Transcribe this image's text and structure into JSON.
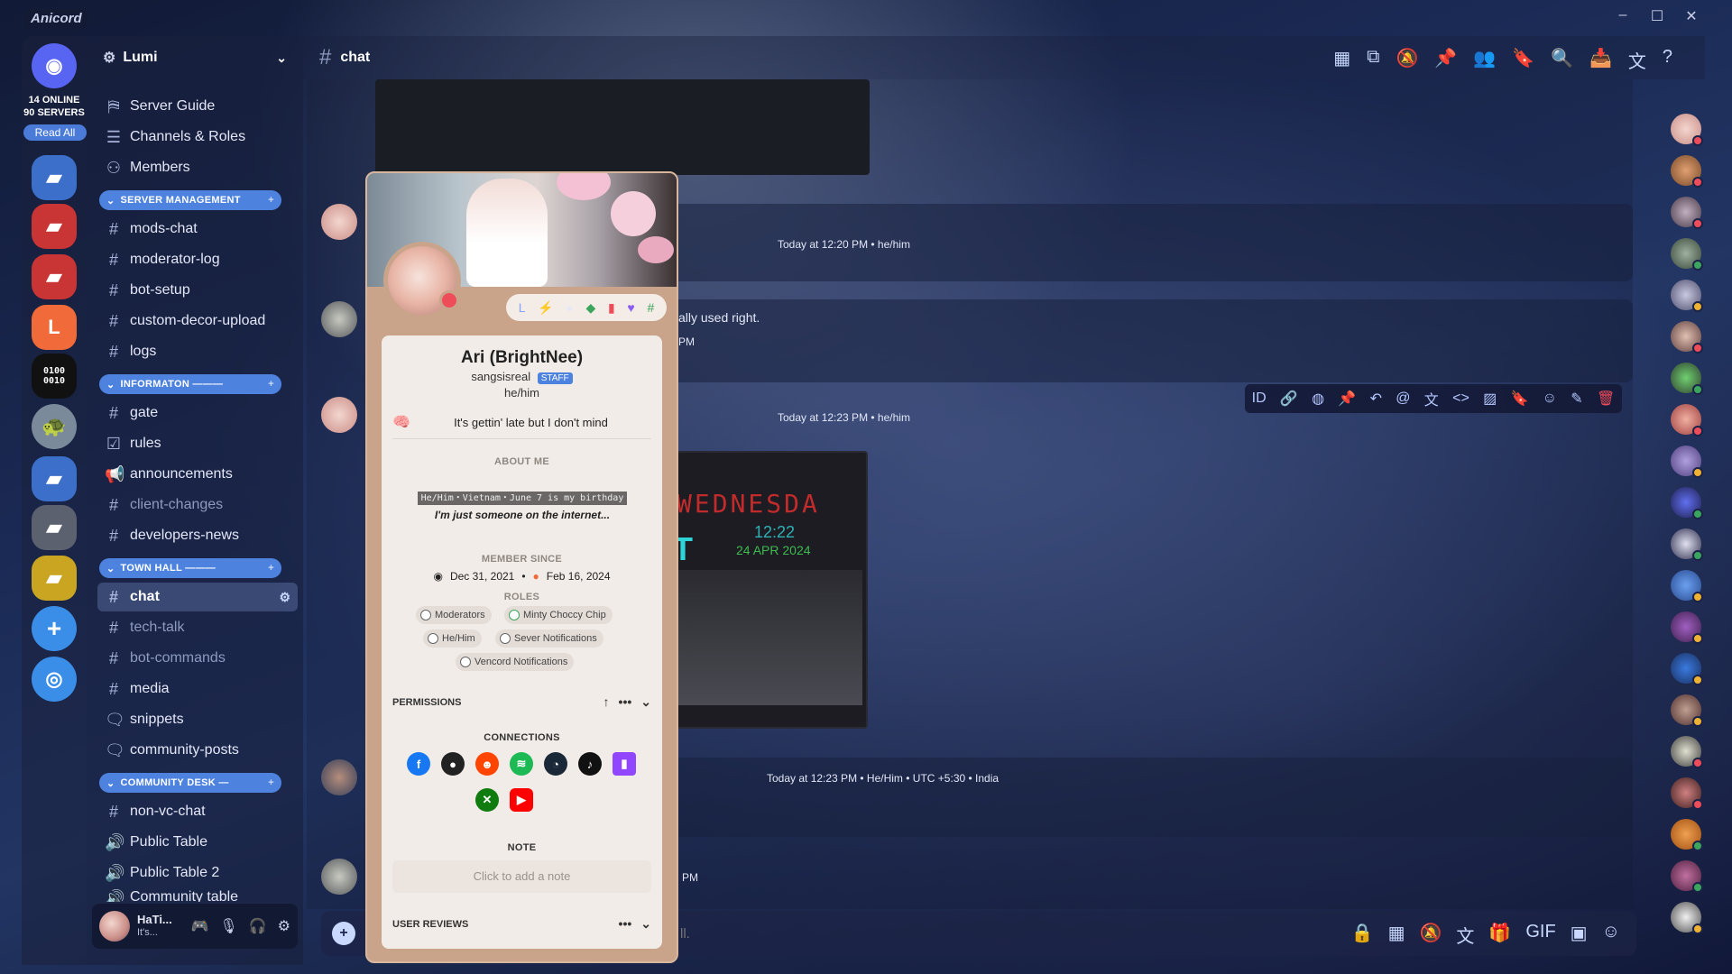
{
  "app": {
    "title": "Anicord",
    "window_controls": [
      "–",
      "☐",
      "✕"
    ]
  },
  "rail": {
    "online": "14 ONLINE",
    "servers": "90 SERVERS",
    "read_all": "Read All"
  },
  "server": {
    "name": "Lumi"
  },
  "channels": {
    "top": [
      {
        "label": "Server Guide",
        "icon": "guide-icon"
      },
      {
        "label": "Channels & Roles",
        "icon": "list-icon"
      },
      {
        "label": "Members",
        "icon": "members-icon"
      }
    ],
    "cat_server_management": "SERVER MANAGEMENT",
    "server_management": [
      "mods-chat",
      "moderator-log",
      "bot-setup",
      "custom-decor-upload",
      "logs"
    ],
    "cat_information": "INFORMATON ———",
    "information": [
      "gate",
      "rules",
      "announcements",
      "client-changes",
      "developers-news"
    ],
    "cat_town_hall": "TOWN HALL ———",
    "town_hall": [
      "chat",
      "tech-talk",
      "bot-commands",
      "media",
      "snippets",
      "community-posts"
    ],
    "cat_community_desk": "COMMUNITY DESK —",
    "community_desk": [
      "non-vc-chat",
      "Public Table",
      "Public Table 2",
      "Community table"
    ]
  },
  "user_panel": {
    "name": "HaTi...",
    "status": "It's..."
  },
  "chat": {
    "channel": "chat",
    "input_placeholder": "ll."
  },
  "messages": [
    {
      "meta": "Today at 12:20 PM • he/him"
    },
    {
      "text": "ally used right."
    },
    {
      "time_fragment": "PM"
    },
    {
      "meta": "Today at 12:23 PM • he/him"
    },
    {
      "meta": "Today at 12:23 PM • He/Him • UTC +5:30 • India"
    },
    {
      "time_fragment": "PM"
    }
  ],
  "screenshot": {
    "word": "WEDNESDA",
    "time": "12:22",
    "date": "24 APR 2024",
    "letter": "T"
  },
  "profile": {
    "display_name": "Ari (BrightNee)",
    "username": "sangsisreal",
    "staff_badge": "STAFF",
    "pronouns": "he/him",
    "status": "It's gettin' late but I don't mind",
    "about_label": "ABOUT ME",
    "about_line1": "He/Him・Vietnam・June 7 is my birthday",
    "about_line2": "I'm just someone on the internet...",
    "member_since_label": "MEMBER SINCE",
    "member_since_discord": "Dec 31, 2021",
    "member_since_server": "Feb 16, 2024",
    "roles_label": "ROLES",
    "roles": [
      "Moderators",
      "Minty Choccy Chip",
      "He/Him",
      "Sever Notifications",
      "Vencord Notifications"
    ],
    "permissions_label": "PERMISSIONS",
    "connections_label": "CONNECTIONS",
    "connections": [
      "facebook",
      "github",
      "reddit",
      "spotify",
      "steam",
      "tiktok",
      "twitch",
      "xbox",
      "youtube"
    ],
    "note_label": "NOTE",
    "note_placeholder": "Click to add a note",
    "reviews_label": "USER REVIEWS"
  },
  "colors": {
    "accent": "#4d82de",
    "danger": "#ef4c5a",
    "card": "#f2ece8",
    "frame": "#c9a48a"
  }
}
